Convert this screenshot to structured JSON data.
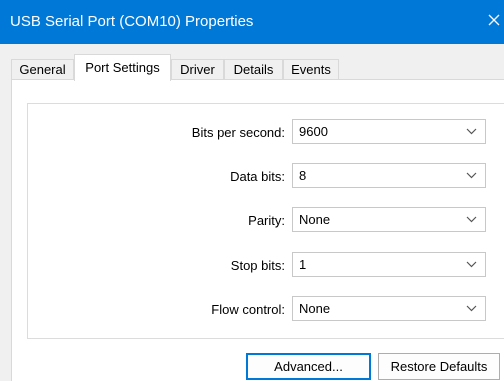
{
  "window": {
    "title": "USB Serial Port (COM10) Properties"
  },
  "tabs": [
    {
      "label": "General"
    },
    {
      "label": "Port Settings"
    },
    {
      "label": "Driver"
    },
    {
      "label": "Details"
    },
    {
      "label": "Events"
    }
  ],
  "active_tab": "Port Settings",
  "settings": [
    {
      "label": "Bits per second:",
      "value": "9600"
    },
    {
      "label": "Data bits:",
      "value": "8"
    },
    {
      "label": "Parity:",
      "value": "None"
    },
    {
      "label": "Stop bits:",
      "value": "1"
    },
    {
      "label": "Flow control:",
      "value": "None"
    }
  ],
  "buttons": {
    "advanced": "Advanced...",
    "restore_defaults": "Restore Defaults"
  },
  "icons": {
    "close": "close-icon",
    "dropdown": "chevron-down-icon"
  },
  "colors": {
    "titlebar": "#0078d7",
    "focus_border": "#0078d7"
  }
}
